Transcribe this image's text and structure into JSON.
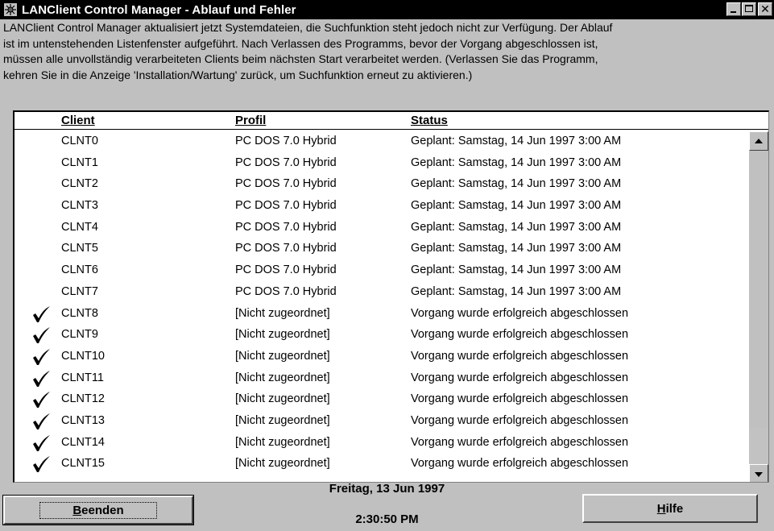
{
  "window": {
    "title": "LANClient Control Manager - Ablauf und Fehler",
    "icon": "lanclient-app-icon",
    "controls": [
      "minimize-icon",
      "maximize-icon",
      "close-icon"
    ]
  },
  "message": {
    "lines": [
      "LANClient Control Manager aktualisiert jetzt Systemdateien, die Suchfunktion steht jedoch nicht zur Verfügung. Der Ablauf",
      "ist im untenstehenden Listenfenster aufgeführt. Nach Verlassen des Programms, bevor der Vorgang abgeschlossen ist,",
      "müssen alle unvollständig verarbeiteten Clients beim nächsten Start verarbeitet werden. (Verlassen Sie das Programm,",
      "kehren Sie in die Anzeige 'Installation/Wartung' zurück, um Suchfunktion erneut zu aktivieren.)"
    ]
  },
  "list": {
    "columns": {
      "client": "Client",
      "profile": "Profil",
      "status": "Status"
    },
    "rows": [
      {
        "done": false,
        "client": "CLNT0",
        "profile": "PC DOS 7.0 Hybrid",
        "status": "Geplant: Samstag, 14 Jun 1997   3:00 AM"
      },
      {
        "done": false,
        "client": "CLNT1",
        "profile": "PC DOS 7.0 Hybrid",
        "status": "Geplant: Samstag, 14 Jun 1997   3:00 AM"
      },
      {
        "done": false,
        "client": "CLNT2",
        "profile": "PC DOS 7.0 Hybrid",
        "status": "Geplant: Samstag, 14 Jun 1997   3:00 AM"
      },
      {
        "done": false,
        "client": "CLNT3",
        "profile": "PC DOS 7.0 Hybrid",
        "status": "Geplant: Samstag, 14 Jun 1997   3:00 AM"
      },
      {
        "done": false,
        "client": "CLNT4",
        "profile": "PC DOS 7.0 Hybrid",
        "status": "Geplant: Samstag, 14 Jun 1997   3:00 AM"
      },
      {
        "done": false,
        "client": "CLNT5",
        "profile": "PC DOS 7.0 Hybrid",
        "status": "Geplant: Samstag, 14 Jun 1997   3:00 AM"
      },
      {
        "done": false,
        "client": "CLNT6",
        "profile": "PC DOS 7.0 Hybrid",
        "status": "Geplant: Samstag, 14 Jun 1997   3:00 AM"
      },
      {
        "done": false,
        "client": "CLNT7",
        "profile": "PC DOS 7.0 Hybrid",
        "status": "Geplant: Samstag, 14 Jun 1997   3:00 AM"
      },
      {
        "done": true,
        "client": "CLNT8",
        "profile": "[Nicht zugeordnet]",
        "status": "Vorgang wurde erfolgreich abgeschlossen"
      },
      {
        "done": true,
        "client": "CLNT9",
        "profile": "[Nicht zugeordnet]",
        "status": "Vorgang wurde erfolgreich abgeschlossen"
      },
      {
        "done": true,
        "client": "CLNT10",
        "profile": "[Nicht zugeordnet]",
        "status": "Vorgang wurde erfolgreich abgeschlossen"
      },
      {
        "done": true,
        "client": "CLNT11",
        "profile": "[Nicht zugeordnet]",
        "status": "Vorgang wurde erfolgreich abgeschlossen"
      },
      {
        "done": true,
        "client": "CLNT12",
        "profile": "[Nicht zugeordnet]",
        "status": "Vorgang wurde erfolgreich abgeschlossen"
      },
      {
        "done": true,
        "client": "CLNT13",
        "profile": "[Nicht zugeordnet]",
        "status": "Vorgang wurde erfolgreich abgeschlossen"
      },
      {
        "done": true,
        "client": "CLNT14",
        "profile": "[Nicht zugeordnet]",
        "status": "Vorgang wurde erfolgreich abgeschlossen"
      },
      {
        "done": true,
        "client": "CLNT15",
        "profile": "[Nicht zugeordnet]",
        "status": "Vorgang wurde erfolgreich abgeschlossen"
      }
    ],
    "check_icon": "checkmark-icon"
  },
  "footer": {
    "date": "Freitag, 13 Jun 1997",
    "time": "2:30:50 PM",
    "exit_button": {
      "label": "Beenden",
      "mnemonic": "B"
    },
    "help_button": {
      "label": "Hilfe",
      "mnemonic": "H"
    }
  }
}
